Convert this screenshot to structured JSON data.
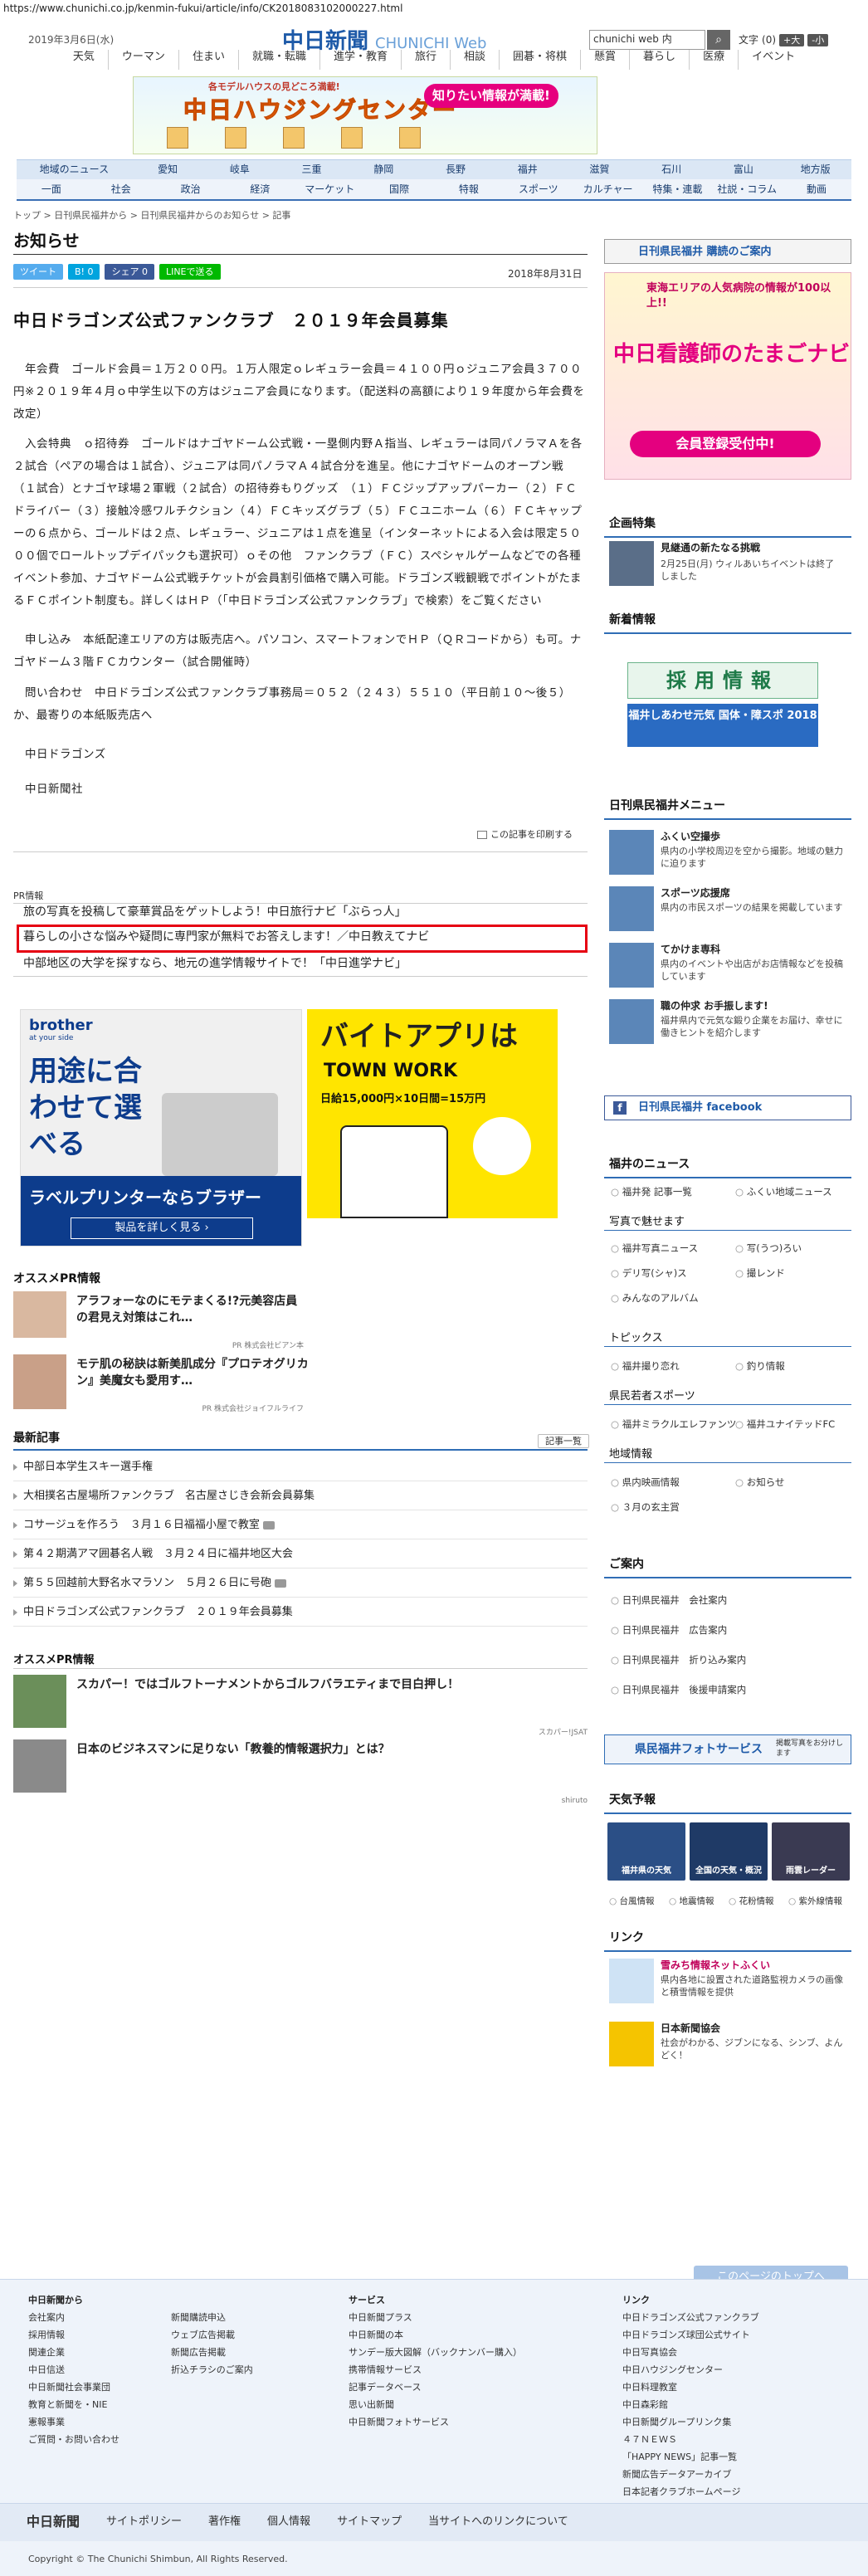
{
  "url": "https://www.chunichi.co.jp/kenmin-fukui/article/info/CK2018083102000227.html",
  "header": {
    "date": "2019年3月6日(水)",
    "logo_ja": "中日新聞",
    "logo_en": "CHUNICHI Web",
    "search_value": "chunichi web 内",
    "search_icon": "search-icon",
    "font_label": "文字",
    "font_reset": "(0)",
    "font_big": "+大",
    "font_small": "-小"
  },
  "global_nav": [
    "天気",
    "ウーマン",
    "住まい",
    "就職・転職",
    "進学・教育",
    "旅行",
    "相談",
    "囲碁・将棋",
    "懸賞",
    "暮らし",
    "医療",
    "イベント"
  ],
  "banner": {
    "subtitle": "各モデルハウスの見どころ満載!",
    "title": "中日ハウジングセンター",
    "badge": "知りたい情報が満載!"
  },
  "region_nav": [
    "地域のニュース",
    "愛知",
    "岐阜",
    "三重",
    "静岡",
    "長野",
    "福井",
    "滋賀",
    "石川",
    "富山",
    "地方版"
  ],
  "category_nav": [
    "一面",
    "社会",
    "政治",
    "経済",
    "マーケット",
    "国際",
    "特報",
    "スポーツ",
    "カルチャー",
    "特集・連載",
    "社説・コラム",
    "動画"
  ],
  "breadcrumb": "トップ > 日刊県民福井から > 日刊県民福井からのお知らせ > 記事",
  "page_title": "お知らせ",
  "social": {
    "tweet": "ツイート",
    "hatena": "B! 0",
    "fb_share": "シェア 0",
    "line": "LINEで送る"
  },
  "pub_date": "2018年8月31日",
  "article": {
    "title": "中日ドラゴンズ公式ファンクラブ　２０１９年会員募集",
    "paragraphs": [
      "　年会費　ゴールド会員＝１万２００円。１万人限定ｏレギュラー会員＝４１００円ｏジュニア会員３７００円※２０１９年４月ｏ中学生以下の方はジュニア会員になります。（配送料の高額により１９年度から年会費を改定）",
      "　入会特典　ｏ招待券　ゴールドはナゴヤドーム公式戦・一塁側内野Ａ指当、レギュラーは同パノラマＡを各２試合（ペアの場合は１試合）、ジュニアは同パノラマＡ４試合分を進呈。他にナゴヤドームのオープン戦（１試合）とナゴヤ球場２軍戦（２試合）の招待券もりグッズ　（１）ＦＣジップアップパーカー（２）ＦＣドライバー（３）接触冷感ワルチクション（４）ＦＣキッズグラブ（５）ＦＣユニホーム（６）ＦＣキャップーの６点から、ゴールドは２点、レギュラー、ジュニアは１点を進呈（インターネットによる入会は限定５０００個でロールトップデイパックも選択可）ｏその他　ファンクラブ（ＦＣ）スペシャルゲームなどでの各種イベント参加、ナゴヤドーム公式戦チケットが会員割引価格で購入可能。ドラゴンズ戦観戦でポイントがたまるＦＣポイント制度も。詳しくはＨＰ（「中日ドラゴンズ公式ファンクラブ」で検索）をご覧ください",
      "　申し込み　本紙配達エリアの方は販売店へ。パソコン、スマートフォンでＨＰ（ＱＲコードから）も可。ナゴヤドーム３階ＦＣカウンター（試合開催時）",
      "　問い合わせ　中日ドラゴンズ公式ファンクラブ事務局＝０５２（２４３）５５１０（平日前１０～後５）か、最寄りの本紙販売店へ",
      "　中日ドラゴンズ",
      "　中日新聞社"
    ],
    "print_label": "この記事を印刷する"
  },
  "pr": {
    "label": "PR情報",
    "lines": [
      "旅の写真を投稿して豪華賞品をゲットしよう！中日旅行ナビ「ぶらっ人」",
      "暮らしの小さな悩みや疑問に専門家が無料でお答えします！／中日教えてナビ",
      "中部地区の大学を探すなら、地元の進学情報サイトで！「中日進学ナビ」"
    ]
  },
  "ads": {
    "brother_logo": "brother",
    "brother_tag": "at your side",
    "brother_copy": "用途に合わせて選べる",
    "brother_title": "ラベルプリンターならブラザー",
    "brother_btn": "製品を詳しく見る ›",
    "townwork_title": "バイトアプリは",
    "townwork_brand": "TOWN WORK",
    "townwork_prize": "日給15,000円×10日間=15万円"
  },
  "osusume": {
    "title": "オススメPR情報",
    "items": [
      {
        "text": "アラフォーなのにモテまくる!?元美容店員の君見え対策はこれ…",
        "src": "PR 株式会社ビアン本"
      },
      {
        "text": "モテ肌の秘訣は新美肌成分『プロテオグリカン』美魔女も愛用す…",
        "src": "PR 株式会社ジョイフルライフ"
      }
    ]
  },
  "latest": {
    "title": "最新記事",
    "more": "記事一覧",
    "items": [
      "中部日本学生スキー選手権",
      "大相撲名古屋場所ファンクラブ　名古屋さじき会新会員募集",
      "コサージュを作ろう　３月１６日福福小屋で教室",
      "第４２期満アマ囲碁名人戦　３月２４日に福井地区大会",
      "第５５回越前大野名水マラソン　５月２６日に号砲",
      "中日ドラゴンズ公式ファンクラブ　２０１９年会員募集"
    ]
  },
  "osusume2": {
    "title": "オススメPR情報",
    "items": [
      {
        "text": "スカパー！ではゴルフトーナメントからゴルフバラエティまで目白押し！",
        "src": "スカパー!JSAT"
      },
      {
        "text": "日本のビジネスマンに足りない「教養的情報選択力」とは？",
        "src": "shiruto"
      }
    ]
  },
  "sidebar": {
    "subscribe": "日刊県民福井 購読のご案内",
    "nurse_title": "中日看護師のたまごナビ",
    "nurse_sub": "東海エリアの人気病院の情報が100以上!!",
    "nurse_badge": "会員登録受付中!",
    "kikaku_title": "企画特集",
    "kikaku_text": "見継通の新たなる挑戦",
    "kikaku_sub": "2月25日(月) ウィルあいちイベントは終了しました",
    "kigyo_title": "新着情報",
    "saiyo": "採用情報",
    "kokutai": "福井しあわせ元気 国体・障スポ 2018",
    "menu_title": "日刊県民福井メニュー",
    "menu": [
      {
        "name": "ふくい空撮歩",
        "desc": "県内の小学校周辺を空から撮影。地域の魅力に迫ります"
      },
      {
        "name": "スポーツ応援席",
        "desc": "県内の市民スポーツの結果を掲載しています"
      },
      {
        "name": "てかけま専科",
        "desc": "県内のイベントや出店がお店情報などを投稿しています"
      },
      {
        "name": "職の仲求 お手振します!",
        "desc": "福井県内で元気な鍛り企業をお届け、幸せに働きヒントを紹介します"
      }
    ],
    "facebook": "日刊県民福井 facebook",
    "fnews_title": "福井のニュース",
    "fnews": [
      "福井発 記事一覧",
      "ふくい地域ニュース"
    ],
    "photo_title": "写真で魅せます",
    "photo": [
      "福井写真ニュース",
      "写(うつ)ろい",
      "デリ写(シャ)ス",
      "撮レンド",
      "みんなのアルバム"
    ],
    "topics_title": "トピックス",
    "topics": [
      "福井撮り恋れ",
      "釣り情報"
    ],
    "sports_title": "県民若者スポーツ",
    "sports": [
      "福井ミラクルエレファンツ",
      "福井ユナイテッドFC"
    ],
    "region_title": "地域情報",
    "region": [
      "県内映画情報",
      "お知らせ",
      "３月の玄主賞"
    ],
    "guide_title": "ご案内",
    "guide": [
      "日刊県民福井　会社案内",
      "日刊県民福井　広告案内",
      "日刊県民福井　折り込み案内",
      "日刊県民福井　後援申請案内"
    ],
    "photo_service": "県民福井フォトサービス",
    "photo_service_sub": "掲載写真をお分けします",
    "weather_title": "天気予報",
    "weather": [
      "福井県の天気",
      "全国の天気・概況",
      "雨雲レーダー"
    ],
    "weather_links": [
      "台風情報",
      "地震情報",
      "花粉情報",
      "紫外線情報"
    ],
    "link_title": "リンク",
    "links": [
      {
        "name": "雪みち情報ネットふくい",
        "desc": "県内各地に設置された道路監視カメラの画像と積雪情報を提供"
      },
      {
        "name": "日本新聞協会",
        "desc": "社会がわかる、ジブンになる、シンブ、よんどく！"
      }
    ]
  },
  "footer": {
    "to_top": "このページのトップへ",
    "col1_title": "中日新聞から",
    "col1": [
      "会社案内",
      "採用情報",
      "関連企業",
      "中日信送",
      "中日新聞社会事業団",
      "教育と新聞を・NIE",
      "憲報事業",
      "ご質問・お問い合わせ"
    ],
    "col2": [
      "新聞購読申込",
      "ウェブ広告掲載",
      "新聞広告掲載",
      "折込チラシのご案内"
    ],
    "col3_title": "サービス",
    "col3": [
      "中日新聞プラス",
      "中日新聞の本",
      "サンデー版大図解（バックナンバー購入）",
      "携帯情報サービス",
      "記事データベース",
      "思い出新聞",
      "中日新聞フォトサービス"
    ],
    "col4_title": "リンク",
    "col4": [
      "中日ドラゴンズ公式ファンクラブ",
      "中日ドラゴンズ球団公式サイト",
      "中日写真協会",
      "中日ハウジングセンター",
      "中日料理教室",
      "中日森彩館",
      "中日新聞グループリンク集",
      "４７ＮＥＷＳ",
      "「HAPPY NEWS」記事一覧",
      "新聞広告データアーカイブ",
      "日本記者クラブホームページ"
    ],
    "bottom": [
      "中日新聞",
      "サイトポリシー",
      "著作権",
      "個人情報",
      "サイトマップ",
      "当サイトへのリンクについて"
    ],
    "copyright": "Copyright © The Chunichi Shimbun, All Rights Reserved."
  }
}
